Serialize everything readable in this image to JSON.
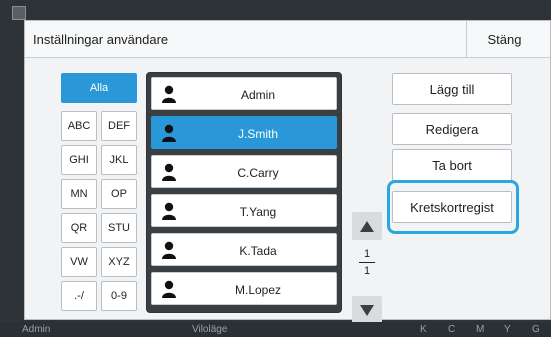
{
  "dialog": {
    "title": "Inställningar användare",
    "close_label": "Stäng"
  },
  "filters": [
    {
      "label": "Alla",
      "active": true
    },
    {
      "label": "ABC"
    },
    {
      "label": "DEF"
    },
    {
      "label": "GHI"
    },
    {
      "label": "JKL"
    },
    {
      "label": "MN"
    },
    {
      "label": "OP"
    },
    {
      "label": "QR"
    },
    {
      "label": "STU"
    },
    {
      "label": "VW"
    },
    {
      "label": "XYZ"
    },
    {
      "label": ".-/"
    },
    {
      "label": "0-9"
    }
  ],
  "users": [
    {
      "name": "Admin"
    },
    {
      "name": "J.Smith",
      "selected": true
    },
    {
      "name": "C.Carry"
    },
    {
      "name": "T.Yang"
    },
    {
      "name": "K.Tada"
    },
    {
      "name": "M.Lopez"
    }
  ],
  "pager": {
    "current": "1",
    "total": "1"
  },
  "actions": {
    "add_label": "Lägg till",
    "edit_label": "Redigera",
    "delete_label": "Ta bort",
    "card_label": "Kretskortregist"
  },
  "statusbar": {
    "user": "Admin",
    "mode": "Viloläge",
    "ink": [
      "K",
      "C",
      "M",
      "Y",
      "G"
    ]
  },
  "colors": {
    "accent": "#2a98d8",
    "highlight": "#2aa6e0"
  }
}
